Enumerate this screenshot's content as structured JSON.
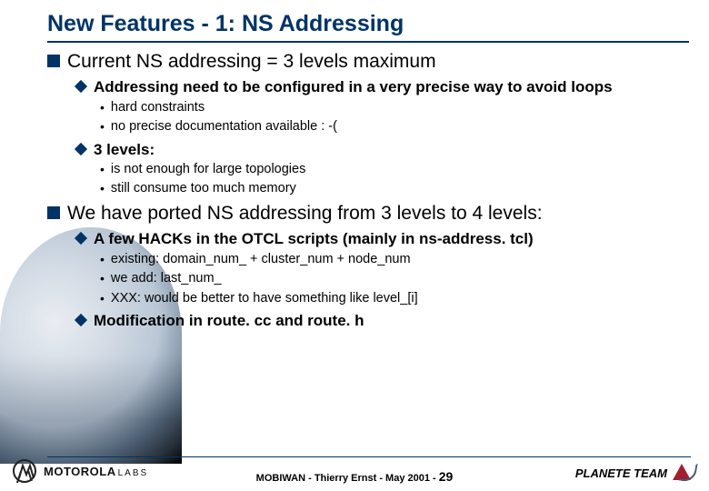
{
  "title": "New Features - 1: NS Addressing",
  "bullets": [
    {
      "level": 1,
      "text": "Current NS addressing = 3 levels maximum",
      "children": [
        {
          "level": 2,
          "text": "Addressing need to be configured in a very precise way to avoid loops",
          "children": [
            {
              "level": 3,
              "text": "hard constraints"
            },
            {
              "level": 3,
              "text": "no precise documentation available : -("
            }
          ]
        },
        {
          "level": 2,
          "text": "3 levels:",
          "children": [
            {
              "level": 3,
              "text": "is not enough for large topologies"
            },
            {
              "level": 3,
              "text": "still consume too much memory"
            }
          ]
        }
      ]
    },
    {
      "level": 1,
      "text": "We have ported NS addressing from 3 levels to 4 levels:",
      "children": [
        {
          "level": 2,
          "text": "A few HACKs in the OTCL scripts (mainly in ns-address. tcl)",
          "children": [
            {
              "level": 3,
              "text": "existing: domain_num_ + cluster_num + node_num"
            },
            {
              "level": 3,
              "text": "we add: last_num_"
            },
            {
              "level": 3,
              "text": "XXX: would be better to have something like level_[i]"
            }
          ]
        },
        {
          "level": 2,
          "text": "Modification in route. cc and route. h",
          "children": []
        }
      ]
    }
  ],
  "footer": {
    "left_brand": "MOTOROLA",
    "left_brand_suffix": "LABS",
    "center_prefix": "MOBIWAN - Thierry Ernst - May 2001 - ",
    "page_number": "29",
    "right_text": "PLANETE TEAM"
  }
}
